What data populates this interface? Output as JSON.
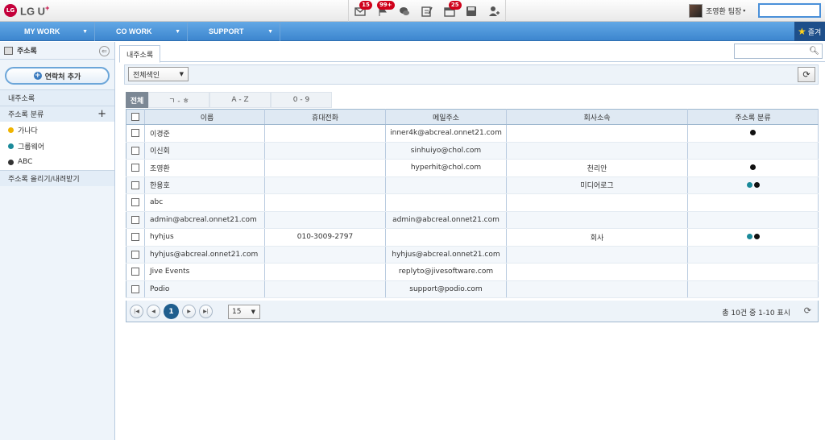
{
  "topbar": {
    "logo_text": "LG U",
    "logo_plus": "+",
    "logo_mark": "LG",
    "notifications": [
      {
        "icon": "mail-icon",
        "badge": "15"
      },
      {
        "icon": "flag-icon",
        "badge": "99+"
      },
      {
        "icon": "chat-icon",
        "badge": ""
      },
      {
        "icon": "edit-icon",
        "badge": ""
      },
      {
        "icon": "calendar-icon",
        "badge": "25"
      },
      {
        "icon": "save-icon",
        "badge": ""
      },
      {
        "icon": "person-icon",
        "badge": ""
      }
    ],
    "user_name": "조영환 팀장",
    "user_caret": "▾"
  },
  "menubar": {
    "items": [
      {
        "label": "MY WORK",
        "arrow": "▼"
      },
      {
        "label": "CO WORK",
        "arrow": "▼"
      },
      {
        "label": "SUPPORT",
        "arrow": "▼"
      }
    ],
    "favorites_label": "즐겨"
  },
  "sidebar": {
    "title": "주소록",
    "back_icon": "⇐",
    "add_button": "연락처 추가",
    "my_addressbook": "내주소록",
    "category_header": "주소록 분류",
    "category_add": "+",
    "categories": [
      {
        "label": "가나다",
        "color": "#f0b400"
      },
      {
        "label": "그룹웨어",
        "color": "#1a8a9a"
      },
      {
        "label": "ABC",
        "color": "#333333"
      }
    ],
    "import_export": "주소록 올리기/내려받기"
  },
  "main": {
    "tab_label": "내주소록",
    "search_placeholder": "",
    "index_select": "전체색인",
    "index_tabs": [
      "전체",
      "ㄱ - ㅎ",
      "A - Z",
      "0 - 9"
    ],
    "table": {
      "headers": [
        "이름",
        "휴대전화",
        "메일주소",
        "회사소속",
        "주소록 분류"
      ],
      "rows": [
        {
          "name": "이경준",
          "phone": "",
          "email": "inner4k@abcreal.onnet21.com",
          "company": "",
          "cats": [
            "#111111"
          ]
        },
        {
          "name": "이신회",
          "phone": "",
          "email": "sinhuiyo@chol.com",
          "company": "",
          "cats": []
        },
        {
          "name": "조영환",
          "phone": "",
          "email": "hyperhit@chol.com",
          "company": "천리안",
          "cats": [
            "#111111"
          ]
        },
        {
          "name": "한용호",
          "phone": "",
          "email": "",
          "company": "미디어로그",
          "cats": [
            "#1a8a9a",
            "#111111"
          ]
        },
        {
          "name": "abc",
          "phone": "",
          "email": "",
          "company": "",
          "cats": []
        },
        {
          "name": "admin@abcreal.onnet21.com",
          "phone": "",
          "email": "admin@abcreal.onnet21.com",
          "company": "",
          "cats": []
        },
        {
          "name": "hyhjus",
          "phone": "010-3009-2797",
          "email": "",
          "company": "회사",
          "cats": [
            "#1a8a9a",
            "#111111"
          ]
        },
        {
          "name": "hyhjus@abcreal.onnet21.com",
          "phone": "",
          "email": "hyhjus@abcreal.onnet21.com",
          "company": "",
          "cats": []
        },
        {
          "name": "Jive Events",
          "phone": "",
          "email": "replyto@jivesoftware.com",
          "company": "",
          "cats": []
        },
        {
          "name": "Podio",
          "phone": "",
          "email": "support@podio.com",
          "company": "",
          "cats": []
        }
      ]
    },
    "pager": {
      "current_page": "1",
      "page_size": "15",
      "info": "총 10건 중 1-10 표시"
    }
  }
}
